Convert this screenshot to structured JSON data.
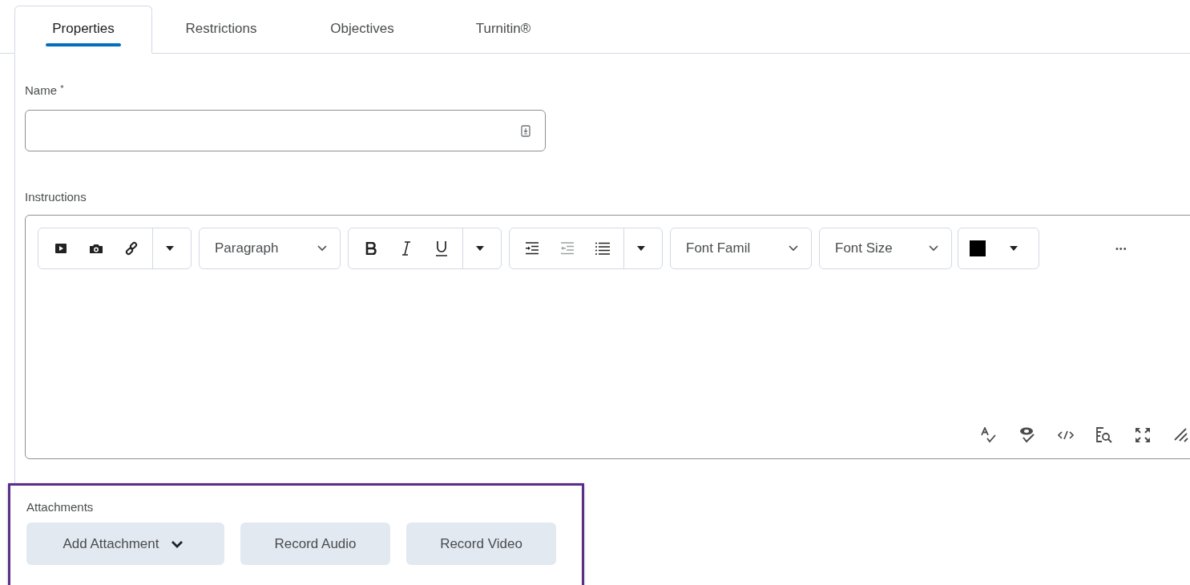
{
  "tabs": [
    {
      "label": "Properties",
      "selected": true
    },
    {
      "label": "Restrictions",
      "selected": false
    },
    {
      "label": "Objectives",
      "selected": false
    },
    {
      "label": "Turnitin®",
      "selected": false
    }
  ],
  "name_field": {
    "label": "Name",
    "required_mark": "*"
  },
  "instructions": {
    "label": "Instructions",
    "format_select": "Paragraph",
    "font_family_select": "Font Famil",
    "font_size_select": "Font Size",
    "more": "•••"
  },
  "attachments": {
    "label": "Attachments",
    "highlighted": true,
    "buttons": [
      {
        "label": "Add Attachment",
        "kind": "menu"
      },
      {
        "label": "Record Audio",
        "kind": "plain"
      },
      {
        "label": "Record Video",
        "kind": "plain"
      }
    ]
  }
}
